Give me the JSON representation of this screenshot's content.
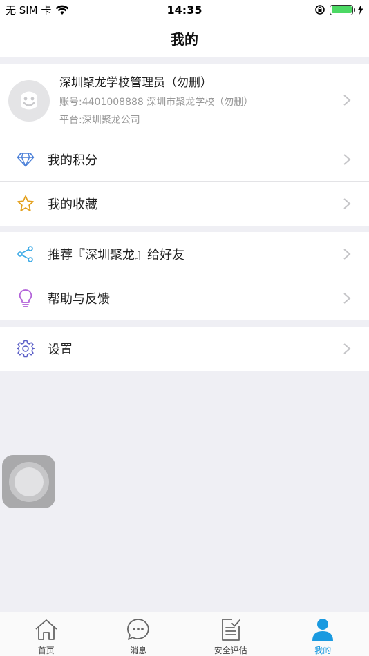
{
  "status_bar": {
    "carrier": "无 SIM 卡",
    "time": "14:35"
  },
  "nav": {
    "title": "我的"
  },
  "profile": {
    "name": "深圳聚龙学校管理员（勿删）",
    "account": "账号:4401008888 深圳市聚龙学校（勿删）",
    "platform": "平台:深圳聚龙公司"
  },
  "menu": [
    {
      "label": "我的积分",
      "icon": "diamond-icon",
      "color": "#4a7fd8"
    },
    {
      "label": "我的收藏",
      "icon": "star-icon",
      "color": "#e3a01d"
    },
    {
      "label": "推荐『深圳聚龙』给好友",
      "icon": "share-icon",
      "color": "#3aa9e6"
    },
    {
      "label": "帮助与反馈",
      "icon": "lightbulb-icon",
      "color": "#b15fd8"
    },
    {
      "label": "设置",
      "icon": "gear-icon",
      "color": "#5b5fc7"
    }
  ],
  "tabbar": {
    "items": [
      {
        "label": "首页",
        "icon": "home-icon"
      },
      {
        "label": "消息",
        "icon": "message-icon"
      },
      {
        "label": "安全评估",
        "icon": "assessment-icon"
      },
      {
        "label": "我的",
        "icon": "user-icon",
        "active": true
      }
    ],
    "active_color": "#1a9ae0"
  }
}
